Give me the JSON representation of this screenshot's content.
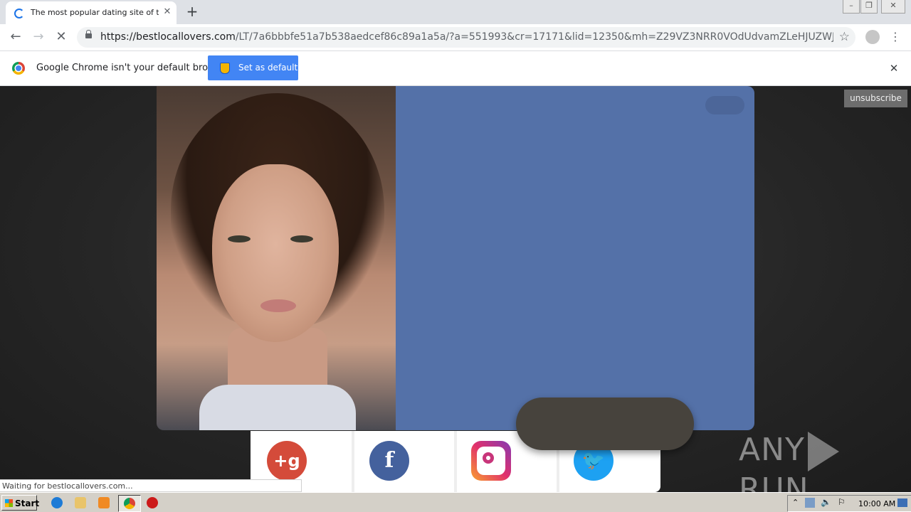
{
  "browser": {
    "tab_title": "The most popular dating site of this",
    "url_host": "https://bestlocallovers.com",
    "url_path": "/LT/7a6bbbfe51a7b538aedcef86c89a1a5a/?a=551993&cr=17171&lid=12350&mh=Z29VZ3NRR0VOdUdvamZLeHJUZWJvUXF3cVFqYUxl...",
    "status_text": "Waiting for bestlocallovers.com..."
  },
  "infobar": {
    "message": "Google Chrome isn't your default browser",
    "button_label": "Set as default"
  },
  "page": {
    "unsubscribe_label": "unsubscribe",
    "social_icons": [
      "google-plus-icon",
      "facebook-icon",
      "instagram-icon",
      "twitter-icon"
    ],
    "watermark": "ANY RUN"
  },
  "taskbar": {
    "start_label": "Start",
    "clock": "10:00 AM"
  },
  "colors": {
    "panel_blue": "#5471a8",
    "setdefault_blue": "#4285f4"
  }
}
